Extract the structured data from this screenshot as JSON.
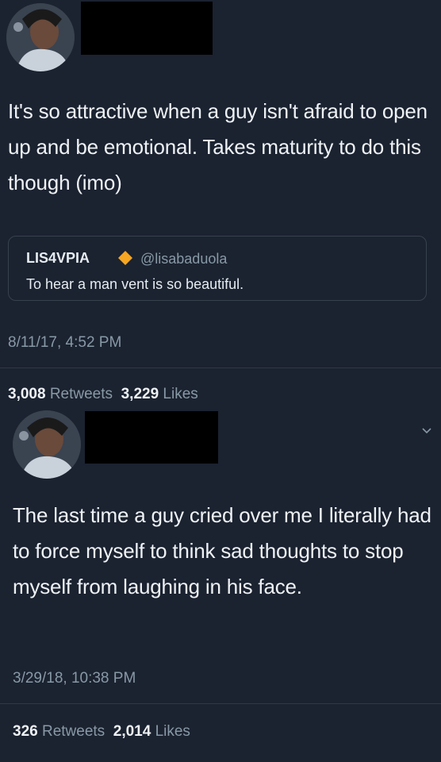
{
  "tweet1": {
    "avatar": "profile-photo",
    "text": "It's so attractive when a guy isn't afraid to open up and be emotional. Takes maturity to do this though (imo)",
    "quote": {
      "name": "LIS4VPIA",
      "badge_icon": "orange-diamond-icon",
      "handle": "@lisabaduola",
      "text": "To hear a man vent is so beautiful."
    },
    "timestamp": "8/11/17, 4:52 PM",
    "stats": {
      "retweets": "3,008",
      "retweets_label": "Retweets",
      "likes": "3,229",
      "likes_label": "Likes"
    }
  },
  "tweet2": {
    "avatar": "profile-photo",
    "menu_icon": "chevron-down-icon",
    "text": "The last time a guy cried over me I literally had to force myself to think sad thoughts to stop myself from laughing in his face.",
    "timestamp": "3/29/18, 10:38 PM",
    "stats": {
      "retweets": "326",
      "retweets_label": "Retweets",
      "likes": "2,014",
      "likes_label": "Likes"
    }
  },
  "colors": {
    "background": "#1b2230",
    "text": "#eef2f5",
    "muted": "#8899a6",
    "badge": "#f5a623",
    "redaction": "#000000"
  }
}
